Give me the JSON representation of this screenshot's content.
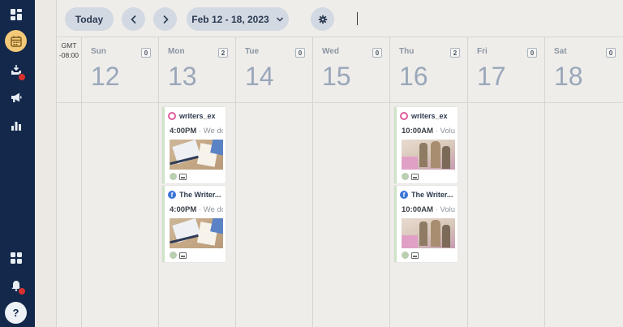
{
  "sidebar": {
    "items": [
      {
        "name": "dashboard-icon"
      },
      {
        "name": "calendar-icon",
        "active": true
      },
      {
        "name": "inbox-icon",
        "badge": true
      },
      {
        "name": "megaphone-icon"
      },
      {
        "name": "analytics-icon"
      }
    ],
    "bottom": [
      {
        "name": "apps-icon"
      },
      {
        "name": "bell-icon",
        "badge": true
      },
      {
        "name": "help-icon",
        "glyph": "?"
      }
    ]
  },
  "toolbar": {
    "today_label": "Today",
    "date_range": "Feb 12 - 18, 2023"
  },
  "timezone": {
    "line1": "GMT",
    "line2": "-08:00"
  },
  "days": [
    {
      "name": "Sun",
      "num": "12",
      "count": "0"
    },
    {
      "name": "Mon",
      "num": "13",
      "count": "2"
    },
    {
      "name": "Tue",
      "num": "14",
      "count": "0"
    },
    {
      "name": "Wed",
      "num": "15",
      "count": "0"
    },
    {
      "name": "Thu",
      "num": "16",
      "count": "2"
    },
    {
      "name": "Fri",
      "num": "17",
      "count": "0"
    },
    {
      "name": "Sat",
      "num": "18",
      "count": "0"
    }
  ],
  "posts": {
    "mon_1": {
      "account": "writers_ex",
      "network": "instagram",
      "time": "4:00PM",
      "sep": " · ",
      "excerpt": "We do"
    },
    "mon_2": {
      "account": "The Writer...",
      "network": "facebook",
      "time": "4:00PM",
      "sep": " · ",
      "excerpt": "We do"
    },
    "thu_1": {
      "account": "writers_ex",
      "network": "instagram",
      "time": "10:00AM",
      "sep": " · ",
      "excerpt": "Volu"
    },
    "thu_2": {
      "account": "The Writer...",
      "network": "facebook",
      "time": "10:00AM",
      "sep": " · ",
      "excerpt": "Volu"
    }
  },
  "colors": {
    "sidebar": "#13284a",
    "active": "#f3c979",
    "badge": "#d9322f",
    "approved_border": "#cfe3c8"
  }
}
